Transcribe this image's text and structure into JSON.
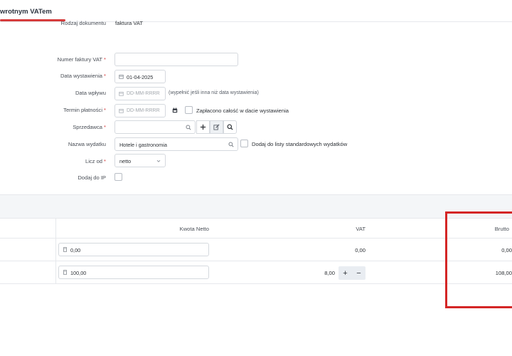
{
  "tab": {
    "title": "wrotnym VATem"
  },
  "form": {
    "doc_type": {
      "label": "Rodzaj dokumentu",
      "value": "faktura VAT"
    },
    "invoice_number": {
      "label": "Numer faktury VAT",
      "required_mark": "*",
      "value": ""
    },
    "issue_date": {
      "label": "Data wystawienia",
      "required_mark": "*",
      "value": "01-04-2025"
    },
    "receipt_date": {
      "label": "Data wpływu",
      "placeholder": "DD-MM-RRRR",
      "hint": "(wypełnić jeśli inna niż data wystawienia)"
    },
    "payment_due": {
      "label": "Termin płatności",
      "required_mark": "*",
      "placeholder": "DD-MM-RRRR",
      "checkbox_label": "Zapłacono całość w dacie wystawienia"
    },
    "seller": {
      "label": "Sprzedawca",
      "required_mark": "*",
      "value": ""
    },
    "expense_name": {
      "label": "Nazwa wydatku",
      "value": "Hotele i gastronomia",
      "checkbox_label": "Dodaj do listy standardowych wydatków"
    },
    "calc_from": {
      "label": "Licz od",
      "required_mark": "*",
      "value": "netto"
    },
    "add_to_ip": {
      "label": "Dodaj do IP"
    }
  },
  "table": {
    "headers": {
      "net": "Kwota Netto",
      "vat": "VAT",
      "gross": "Brutto"
    },
    "rows": [
      {
        "net": "0,00",
        "vat": "0,00",
        "gross": "0,00"
      },
      {
        "net": "100,00",
        "vat": "8,00",
        "gross": "108,00"
      }
    ],
    "stepper": {
      "plus": "+",
      "minus": "−"
    }
  },
  "colors": {
    "accent": "#d63c3c",
    "highlight_box": "#d42626"
  }
}
